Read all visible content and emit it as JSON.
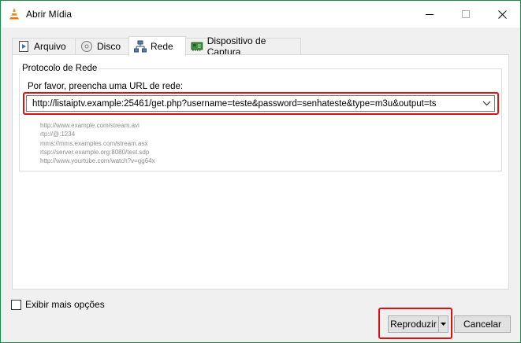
{
  "window": {
    "title": "Abrir Mídia",
    "app_icon": "vlc-cone-icon",
    "controls": [
      "minimize-icon",
      "maximize-icon",
      "close-icon"
    ]
  },
  "tabs": [
    {
      "label": "Arquivo",
      "icon": "file-play-icon",
      "active": false
    },
    {
      "label": "Disco",
      "icon": "disc-icon",
      "active": false
    },
    {
      "label": "Rede",
      "icon": "network-icon",
      "active": true
    },
    {
      "label": "Dispositivo de Captura",
      "icon": "capture-card-icon",
      "active": false
    }
  ],
  "network": {
    "group_title": "Protocolo de Rede",
    "url_label": "Por favor, preencha uma URL de rede:",
    "url_value": "http://listaiptv.example:25461/get.php?username=teste&password=senhateste&type=m3u&output=ts",
    "examples": [
      "http://www.example.com/stream.avi",
      "rtp://@:1234",
      "mms://mms.examples.com/stream.asx",
      "rtsp://server.example.org:8080/test.sdp",
      "http://www.yourtube.com/watch?v=gg64x"
    ]
  },
  "options": {
    "show_more_label": "Exibir mais opções",
    "show_more_checked": false
  },
  "actions": {
    "play_label": "Reproduzir",
    "cancel_label": "Cancelar"
  },
  "colors": {
    "window_border": "#1e8a4a",
    "highlight": "#e01010",
    "dialog_bg": "#f0f0f0",
    "button_bg": "#e1e1e1"
  }
}
